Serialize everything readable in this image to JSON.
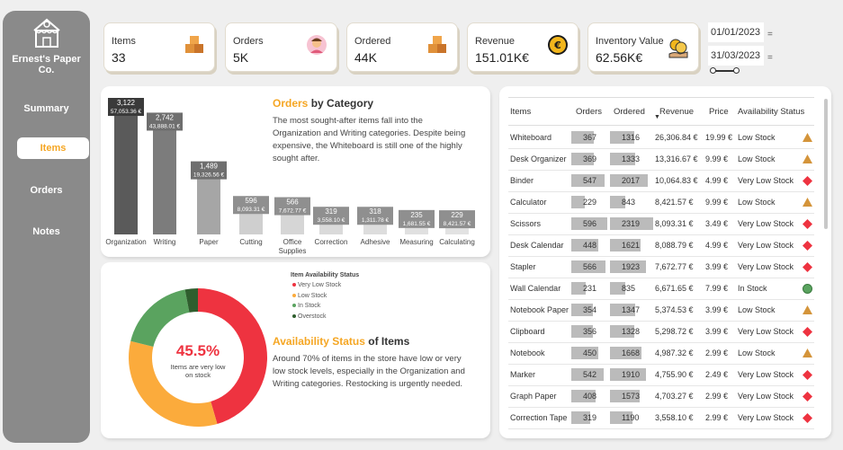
{
  "sidebar": {
    "brand": "Ernest's Paper Co.",
    "nav": [
      {
        "label": "Summary"
      },
      {
        "label": "Items"
      },
      {
        "label": "Orders"
      },
      {
        "label": "Notes"
      }
    ]
  },
  "kpis": [
    {
      "label": "Items",
      "value": "33",
      "icon": "boxes-icon"
    },
    {
      "label": "Orders",
      "value": "5K",
      "icon": "person-icon"
    },
    {
      "label": "Ordered",
      "value": "44K",
      "icon": "boxes-icon"
    },
    {
      "label": "Revenue",
      "value": "151.01K€",
      "icon": "euro-coin-icon"
    },
    {
      "label": "Inventory Value",
      "value": "62.56K€",
      "icon": "money-hand-icon"
    }
  ],
  "dates": {
    "start": "01/01/2023",
    "end": "31/03/2023"
  },
  "orders_panel": {
    "title_accent": "Orders",
    "title_rest": " by Category",
    "description": "The most sought-after items fall into the Organization and Writing categories. Despite being expensive, the Whiteboard is still one of the highly sought after."
  },
  "availability_panel": {
    "title_accent": "Availability Status",
    "title_rest": " of Items",
    "description": "Around 70% of items in the store have low or very low stock levels, especially in the Organization and Writing categories. Restocking is urgently needed.",
    "center_value": "45.5%",
    "center_caption": "Items are very low on stock",
    "legend_title": "Item Availability Status"
  },
  "chart_data": [
    {
      "type": "bar",
      "title": "Orders by Category",
      "categories": [
        "Organization",
        "Writing",
        "Paper",
        "Cutting",
        "Office Supplies",
        "Correction",
        "Adhesive",
        "Measuring",
        "Calculating"
      ],
      "values": [
        3122,
        2742,
        1489,
        596,
        566,
        319,
        318,
        235,
        229
      ],
      "value_labels": [
        "3,122",
        "2,742",
        "1,489",
        "596",
        "566",
        "319",
        "318",
        "235",
        "229"
      ],
      "revenue_labels": [
        "57,053.36 €",
        "43,888.01 €",
        "19,326.56 €",
        "8,093.31 €",
        "7,672.77 €",
        "3,558.10 €",
        "1,311.78 €",
        "1,681.55 €",
        "8,421.57 €"
      ],
      "colors": [
        "#5a5a5a",
        "#7c7c7c",
        "#a6a6a6",
        "#cfcfcf",
        "#d6d6d6",
        "#dadada",
        "#dddddd",
        "#e0e0e0",
        "#e2e2e2"
      ],
      "ylim": [
        0,
        3122
      ]
    },
    {
      "type": "pie",
      "title": "Item Availability Status",
      "labels": [
        "Very Low Stock",
        "Low Stock",
        "In Stock",
        "Overstock"
      ],
      "values": [
        45.5,
        33.3,
        18.2,
        3.0
      ],
      "colors": [
        "#ee3340",
        "#fbab3c",
        "#5aa35f",
        "#2f5e2e"
      ]
    }
  ],
  "table": {
    "headers": [
      "Items",
      "Orders",
      "Ordered",
      "Revenue",
      "Price",
      "Availability Status"
    ],
    "orders_max": 596,
    "ordered_max": 2319,
    "rows": [
      {
        "item": "Whiteboard",
        "orders": 367,
        "ordered": 1316,
        "orders_t": "367",
        "ordered_t": "1316",
        "revenue": "26,306.84 €",
        "price": "19.99 €",
        "status": "Low Stock",
        "icon": "triangle"
      },
      {
        "item": "Desk Organizer",
        "orders": 369,
        "ordered": 1333,
        "orders_t": "369",
        "ordered_t": "1333",
        "revenue": "13,316.67 €",
        "price": "9.99 €",
        "status": "Low Stock",
        "icon": "triangle"
      },
      {
        "item": "Binder",
        "orders": 547,
        "ordered": 2017,
        "orders_t": "547",
        "ordered_t": "2017",
        "revenue": "10,064.83 €",
        "price": "4.99 €",
        "status": "Very Low Stock",
        "icon": "diamond"
      },
      {
        "item": "Calculator",
        "orders": 229,
        "ordered": 843,
        "orders_t": "229",
        "ordered_t": "843",
        "revenue": "8,421.57 €",
        "price": "9.99 €",
        "status": "Low Stock",
        "icon": "triangle"
      },
      {
        "item": "Scissors",
        "orders": 596,
        "ordered": 2319,
        "orders_t": "596",
        "ordered_t": "2319",
        "revenue": "8,093.31 €",
        "price": "3.49 €",
        "status": "Very Low Stock",
        "icon": "diamond"
      },
      {
        "item": "Desk Calendar",
        "orders": 448,
        "ordered": 1621,
        "orders_t": "448",
        "ordered_t": "1621",
        "revenue": "8,088.79 €",
        "price": "4.99 €",
        "status": "Very Low Stock",
        "icon": "diamond"
      },
      {
        "item": "Stapler",
        "orders": 566,
        "ordered": 1923,
        "orders_t": "566",
        "ordered_t": "1923",
        "revenue": "7,672.77 €",
        "price": "3.99 €",
        "status": "Very Low Stock",
        "icon": "diamond"
      },
      {
        "item": "Wall Calendar",
        "orders": 231,
        "ordered": 835,
        "orders_t": "231",
        "ordered_t": "835",
        "revenue": "6,671.65 €",
        "price": "7.99 €",
        "status": "In Stock",
        "icon": "circle"
      },
      {
        "item": "Notebook Paper",
        "orders": 354,
        "ordered": 1347,
        "orders_t": "354",
        "ordered_t": "1347",
        "revenue": "5,374.53 €",
        "price": "3.99 €",
        "status": "Low Stock",
        "icon": "triangle"
      },
      {
        "item": "Clipboard",
        "orders": 356,
        "ordered": 1328,
        "orders_t": "356",
        "ordered_t": "1328",
        "revenue": "5,298.72 €",
        "price": "3.99 €",
        "status": "Very Low Stock",
        "icon": "diamond"
      },
      {
        "item": "Notebook",
        "orders": 450,
        "ordered": 1668,
        "orders_t": "450",
        "ordered_t": "1668",
        "revenue": "4,987.32 €",
        "price": "2.99 €",
        "status": "Low Stock",
        "icon": "triangle"
      },
      {
        "item": "Marker",
        "orders": 542,
        "ordered": 1910,
        "orders_t": "542",
        "ordered_t": "1910",
        "revenue": "4,755.90 €",
        "price": "2.49 €",
        "status": "Very Low Stock",
        "icon": "diamond"
      },
      {
        "item": "Graph Paper",
        "orders": 408,
        "ordered": 1573,
        "orders_t": "408",
        "ordered_t": "1573",
        "revenue": "4,703.27 €",
        "price": "2.99 €",
        "status": "Very Low Stock",
        "icon": "diamond"
      },
      {
        "item": "Correction Tape",
        "orders": 319,
        "ordered": 1190,
        "orders_t": "319",
        "ordered_t": "1190",
        "revenue": "3,558.10 €",
        "price": "2.99 €",
        "status": "Very Low Stock",
        "icon": "diamond"
      }
    ]
  },
  "colors": {
    "accent": "#f5a623",
    "very_low": "#ee3340",
    "low": "#d4943a",
    "in_stock": "#5aa35f"
  }
}
